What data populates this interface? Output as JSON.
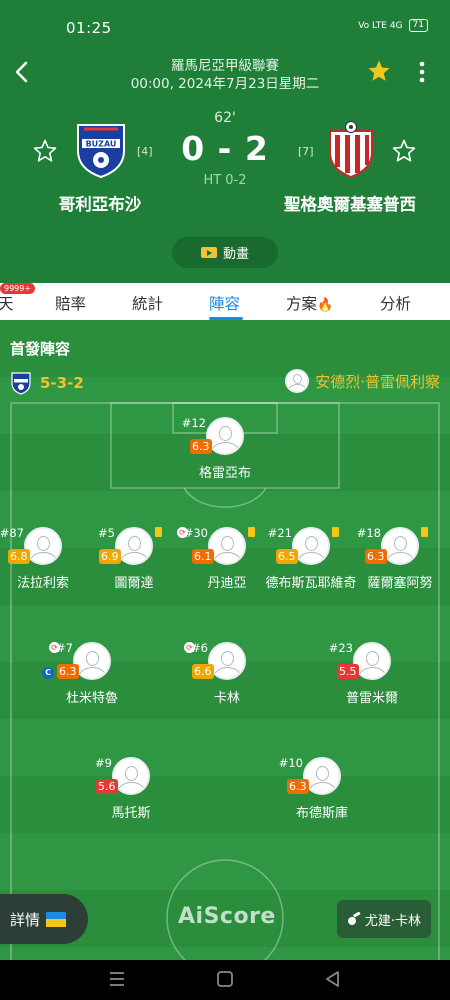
{
  "status_bar": {
    "time": "01:25",
    "icons": "Vo LTE 4G",
    "battery": "71"
  },
  "header": {
    "league": "羅馬尼亞甲級聯賽",
    "date": "00:00, 2024年7月23日星期二",
    "minute": "62'",
    "score": "0 - 2",
    "halftime": "HT 0-2",
    "home": {
      "name": "哥利亞布沙",
      "rank": "[4]",
      "logo_text": "BUZAU"
    },
    "away": {
      "name": "聖格奧爾基塞普西",
      "rank": "[7]"
    },
    "animation_label": "動畫",
    "colors": {
      "header_bg": "#1f7f39",
      "favorite_star": "#f5c518"
    }
  },
  "tabs": {
    "badge": "9999+",
    "items": [
      {
        "label": "天"
      },
      {
        "label": "賠率"
      },
      {
        "label": "統計"
      },
      {
        "label": "陣容"
      },
      {
        "label": "方案"
      },
      {
        "label": "分析"
      }
    ],
    "active_index": 3
  },
  "lineup": {
    "title": "首發陣容",
    "formation": "5-3-2",
    "coach": "安德烈·普雷佩利察",
    "players": [
      {
        "number": "#12",
        "rating": "6.3",
        "name": "格雷亞布",
        "rating_color": "orange"
      },
      {
        "number": "#87",
        "rating": "6.8",
        "name": "法拉利索",
        "rating_color": "yellow"
      },
      {
        "number": "#5",
        "rating": "6.9",
        "name": "圖爾達",
        "rating_color": "yellow",
        "yellow_card": true
      },
      {
        "number": "#30",
        "rating": "6.1",
        "name": "丹迪亞",
        "rating_color": "orange",
        "substituted": true,
        "yellow_card": true
      },
      {
        "number": "#21",
        "rating": "6.5",
        "name": "德布斯瓦耶維奇",
        "rating_color": "yellow",
        "yellow_card": true
      },
      {
        "number": "#18",
        "rating": "6.3",
        "name": "薩爾塞阿努",
        "rating_color": "orange",
        "yellow_card": true
      },
      {
        "number": "#7",
        "rating": "6.3",
        "name": "杜米特魯",
        "rating_color": "orange",
        "substituted": true,
        "captain": true,
        "captain_label": "C"
      },
      {
        "number": "#6",
        "rating": "6.6",
        "name": "卡林",
        "rating_color": "yellow",
        "substituted": true
      },
      {
        "number": "#23",
        "rating": "5.5",
        "name": "普雷米爾",
        "rating_color": "red"
      },
      {
        "number": "#9",
        "rating": "5.6",
        "name": "馬托斯",
        "rating_color": "red"
      },
      {
        "number": "#10",
        "rating": "6.3",
        "name": "布德斯庫",
        "rating_color": "orange"
      }
    ],
    "details_label": "詳情",
    "watermark": "AiScore",
    "referee": "尤建·卡林"
  }
}
